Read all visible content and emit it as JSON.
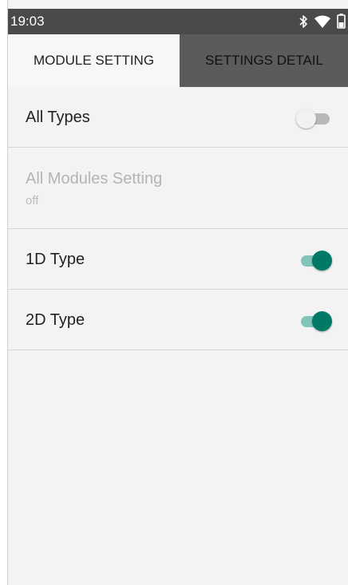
{
  "status_bar": {
    "time": "19:03",
    "icons": [
      "bluetooth-icon",
      "wifi-icon",
      "battery-icon"
    ]
  },
  "tabs": [
    {
      "label": "MODULE SETTING",
      "active": true
    },
    {
      "label": "SETTINGS DETAIL",
      "active": false
    }
  ],
  "settings": [
    {
      "title": "All Types",
      "toggle": "off"
    },
    {
      "title": "All Modules Setting",
      "subtitle": "off",
      "disabled": true
    },
    {
      "title": "1D Type",
      "toggle": "on"
    },
    {
      "title": "2D Type",
      "toggle": "on"
    }
  ],
  "colors": {
    "accent": "#007a66",
    "accent_track": "#80c4ba",
    "status_bar": "#4a4a4a",
    "inactive_tab": "#5b5b5b",
    "background": "#f3f3f3"
  }
}
